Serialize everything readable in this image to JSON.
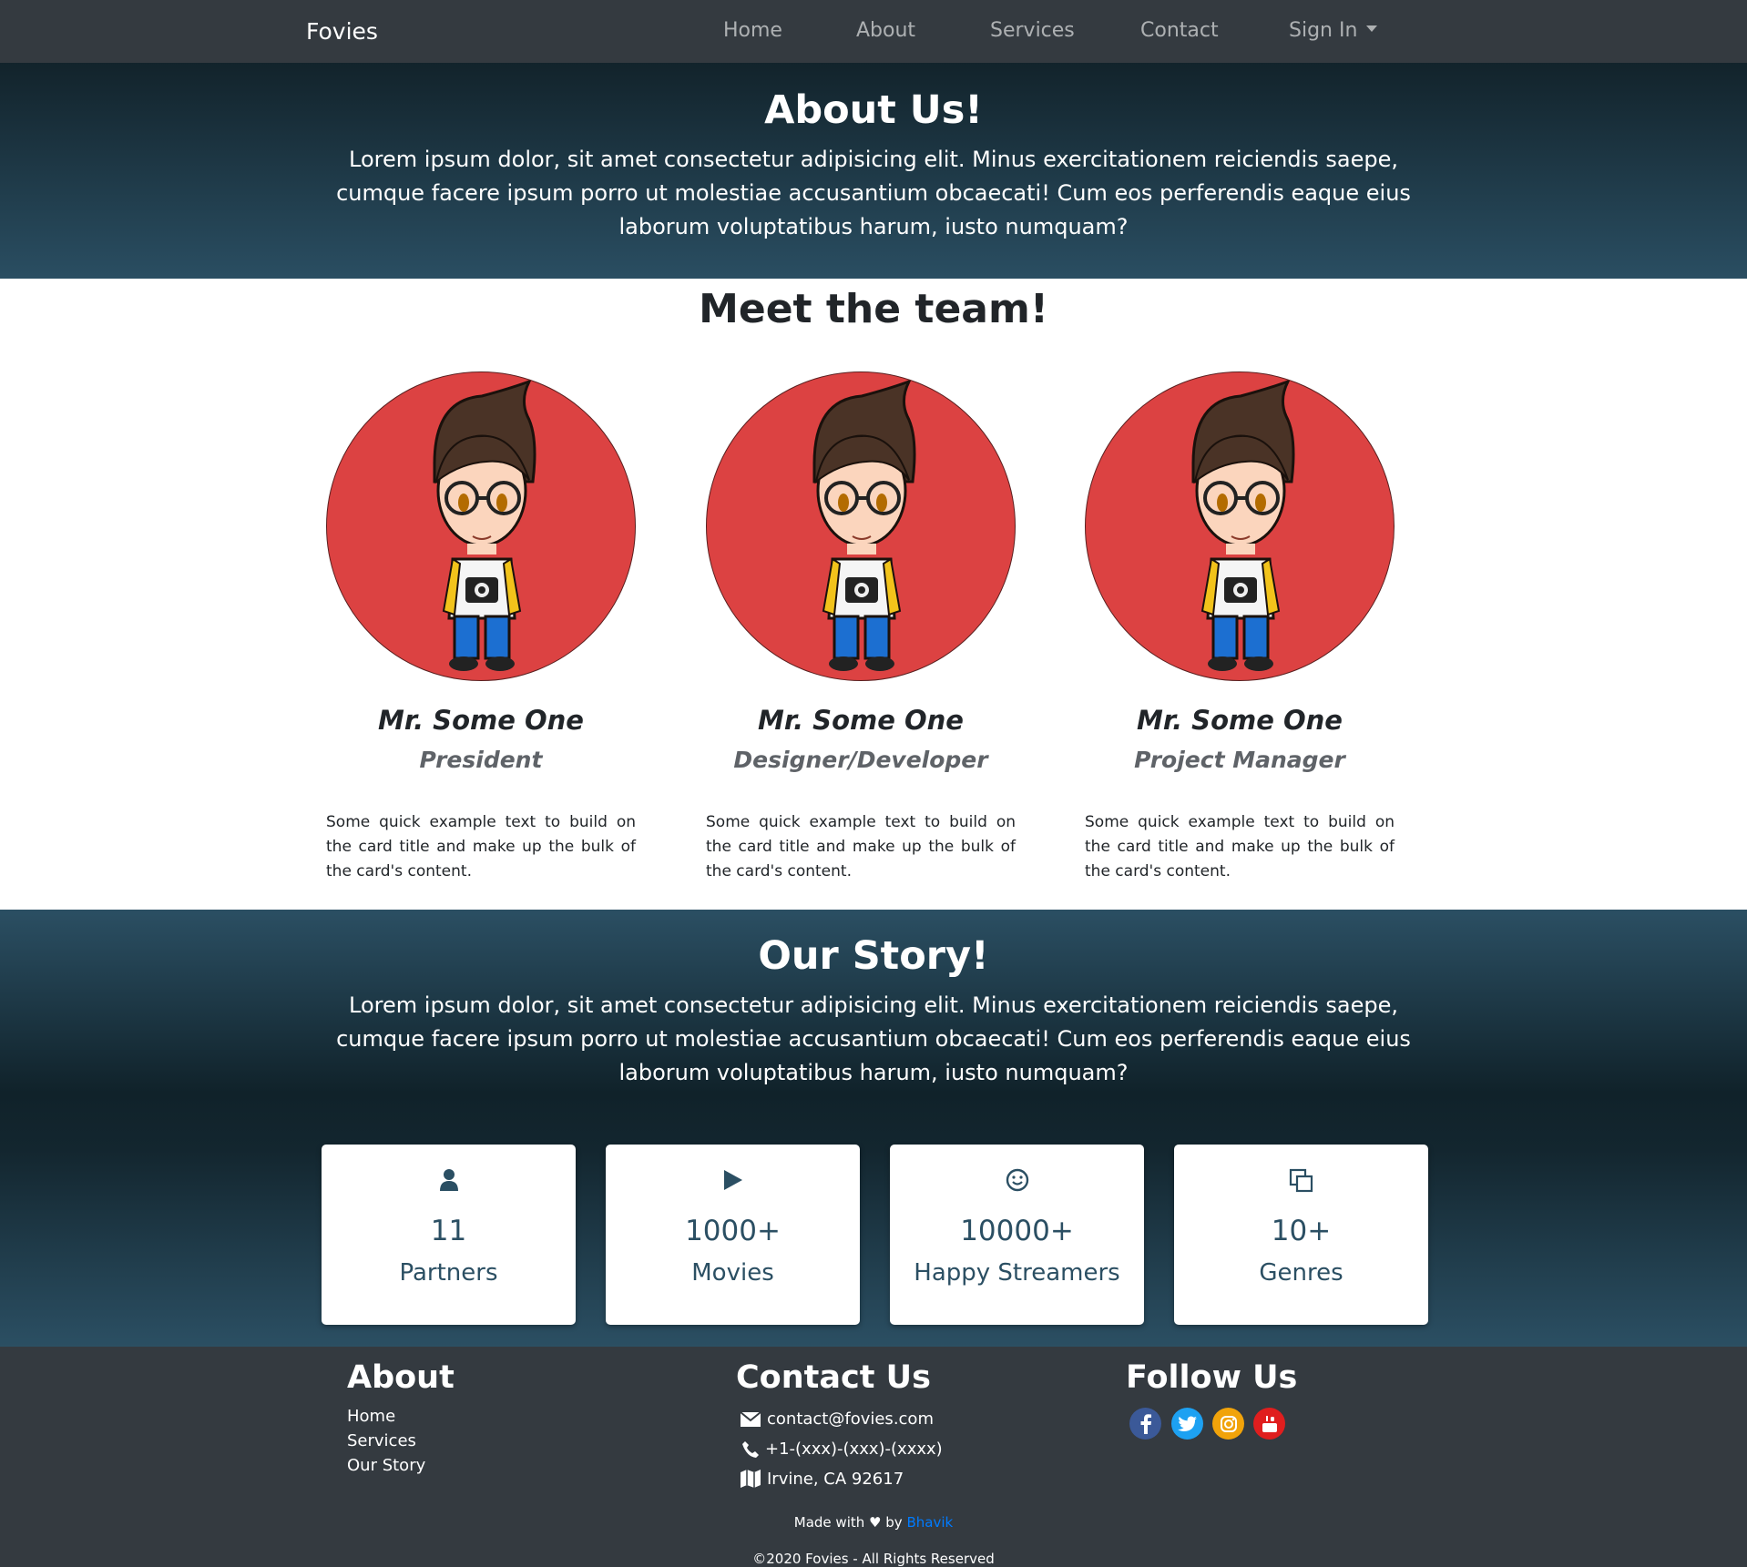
{
  "nav": {
    "brand": "Fovies",
    "items": [
      {
        "label": "Home"
      },
      {
        "label": "About"
      },
      {
        "label": "Services"
      },
      {
        "label": "Contact"
      },
      {
        "label": "Sign In"
      }
    ]
  },
  "about": {
    "title": "About Us!",
    "text": "Lorem ipsum dolor, sit amet consectetur adipisicing elit. Minus exercitationem reiciendis saepe, cumque facere ipsum porro ut molestiae accusantium obcaecati! Cum eos perferendis eaque eius laborum voluptatibus harum, iusto numquam?"
  },
  "team": {
    "title": "Meet the team!",
    "members": [
      {
        "name": "Mr. Some One",
        "role": "President",
        "text": "Some quick example text to build on the card title and make up the bulk of the card's content."
      },
      {
        "name": "Mr. Some One",
        "role": "Designer/Developer",
        "text": "Some quick example text to build on the card title and make up the bulk of the card's content."
      },
      {
        "name": "Mr. Some One",
        "role": "Project Manager",
        "text": "Some quick example text to build on the card title and make up the bulk of the card's content."
      }
    ]
  },
  "story": {
    "title": "Our Story!",
    "text": "Lorem ipsum dolor, sit amet consectetur adipisicing elit. Minus exercitationem reiciendis saepe, cumque facere ipsum porro ut molestiae accusantium obcaecati! Cum eos perferendis eaque eius laborum voluptatibus harum, iusto numquam?",
    "stats": [
      {
        "icon": "user-icon",
        "value": "11",
        "label": "Partners"
      },
      {
        "icon": "play-icon",
        "value": "1000+",
        "label": "Movies"
      },
      {
        "icon": "smile-icon",
        "value": "10000+",
        "label": "Happy Streamers"
      },
      {
        "icon": "copy-icon",
        "value": "10+",
        "label": "Genres"
      }
    ]
  },
  "footer": {
    "about_title": "About",
    "about_links": [
      "Home",
      "Services",
      "Our Story"
    ],
    "contact_title": "Contact Us",
    "contact": {
      "email": "contact@fovies.com",
      "phone": "+1-(xxx)-(xxx)-(xxxx)",
      "address": "Irvine, CA 92617"
    },
    "follow_title": "Follow Us",
    "social": [
      "facebook-icon",
      "twitter-icon",
      "instagram-icon",
      "youtube-icon"
    ],
    "made_with_prefix": "Made with",
    "made_with_by": "by",
    "author": "Bhavik",
    "copyright": "©2020 Fovies - All Rights Reserved"
  },
  "colors": {
    "navbar": "#343a40",
    "hero_dark": "#12232b",
    "hero_light": "#2a4e62",
    "avatar_bg": "#dc4242",
    "stat_text": "#2b4f63",
    "link_blue": "#007bff"
  }
}
